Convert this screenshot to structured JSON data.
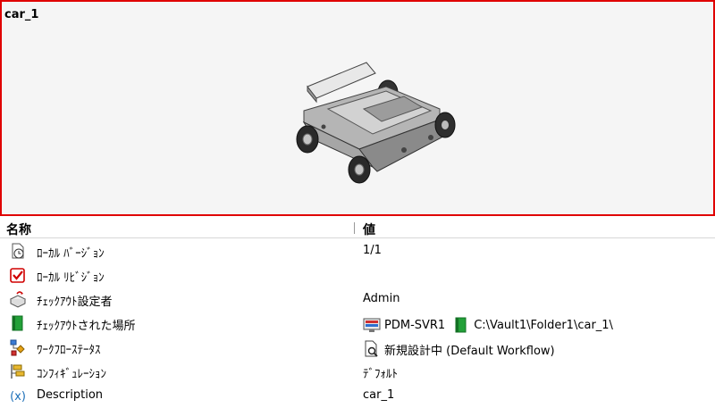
{
  "preview": {
    "title": "car_1"
  },
  "table": {
    "header_name": "名称",
    "header_value": "値",
    "rows": [
      {
        "icon": "clock-document-icon",
        "label": "ﾛｰｶﾙ ﾊﾞｰｼﾞｮﾝ",
        "value": "1/1"
      },
      {
        "icon": "red-checkbox-icon",
        "label": "ﾛｰｶﾙ ﾘﾋﾞｼﾞｮﾝ",
        "value": ""
      },
      {
        "icon": "user-checkout-icon",
        "label": "ﾁｪｯｸｱｳﾄ設定者",
        "value": "Admin"
      },
      {
        "icon": "green-book-icon",
        "label": "ﾁｪｯｸｱｳﾄされた場所",
        "value_server": "PDM-SVR1",
        "value_path": "C:\\Vault1\\Folder1\\car_1\\"
      },
      {
        "icon": "workflow-icon",
        "label": "ﾜｰｸﾌﾛｰｽﾃｰﾀｽ",
        "value": "新規設計中 (Default Workflow)"
      },
      {
        "icon": "configuration-icon",
        "label": "ｺﾝﾌｨｷﾞｭﾚｰｼｮﾝ",
        "value": "ﾃﾞﾌｫﾙﾄ"
      },
      {
        "icon": "variable-x-icon",
        "label": "Description",
        "value": "car_1"
      }
    ]
  },
  "colors": {
    "preview_border": "#e00000",
    "checkbox_red": "#d00000",
    "book_green": "#22a038",
    "variable_blue": "#1c6fb8"
  }
}
